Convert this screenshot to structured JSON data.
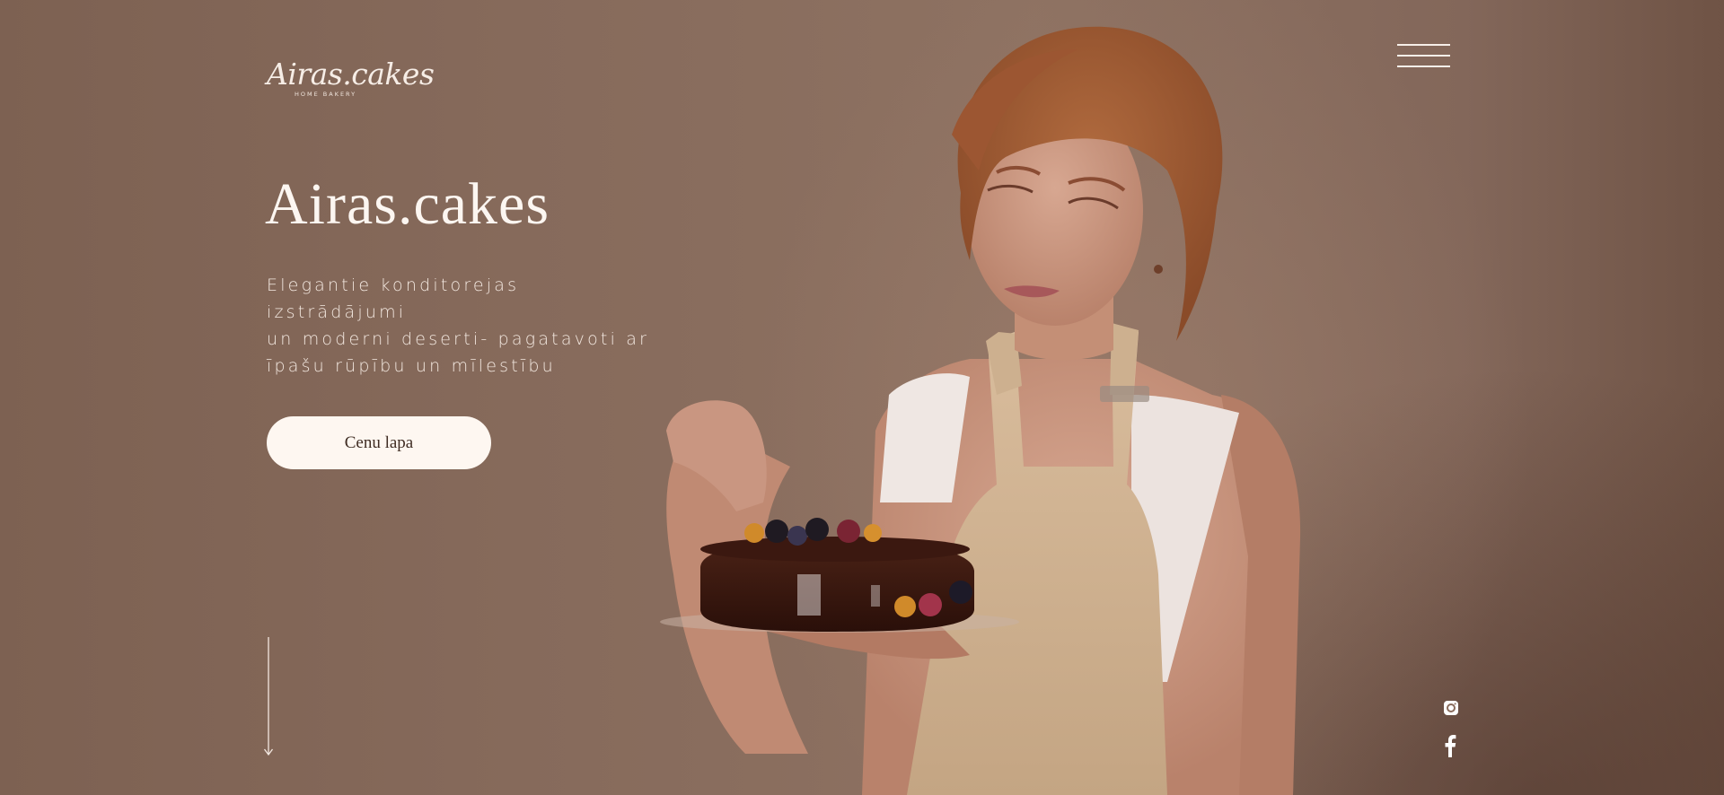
{
  "brand": {
    "logo_text": "Airas.cakes",
    "logo_tagline": "HOME BAKERY"
  },
  "header": {
    "menu_icon": "hamburger-menu-icon"
  },
  "hero": {
    "title": "Airas.cakes",
    "tagline_lines": [
      "Elegantie konditorejas izstrādājumi",
      "un moderni deserti- pagatavoti ar",
      "īpašu rūpību un mīlestību"
    ],
    "cta_label": "Cenu lapa"
  },
  "social": {
    "icons": [
      "instagram-icon",
      "facebook-icon"
    ]
  },
  "colors": {
    "background": "#8a6c5d",
    "text_light": "#fcf6f1",
    "button_bg": "#fef7f1",
    "button_text": "#3f2c23"
  }
}
